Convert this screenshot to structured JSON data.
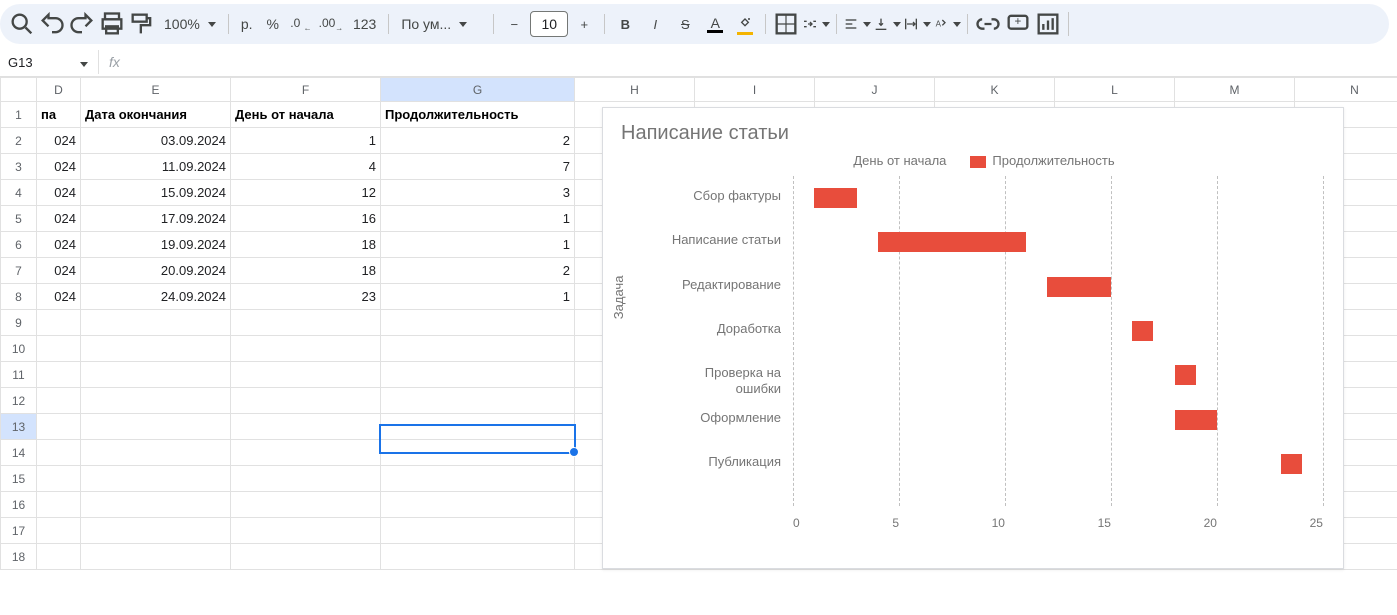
{
  "toolbar": {
    "zoom": "100%",
    "currency": "р.",
    "percent": "%",
    "dec_dec": ".0",
    "dec_inc": ".00",
    "num_123": "123",
    "font_style": "По ум...",
    "font_size": "10"
  },
  "namebox": {
    "cell": "G13",
    "fx": "fx"
  },
  "columns": [
    "D",
    "E",
    "F",
    "G",
    "H",
    "I",
    "J",
    "K",
    "L",
    "M",
    "N"
  ],
  "row_numbers": [
    1,
    2,
    3,
    4,
    5,
    6,
    7,
    8,
    9,
    10,
    11,
    12,
    13,
    14,
    15,
    16,
    17,
    18
  ],
  "headers": {
    "D": "па",
    "E": "Дата окончания",
    "F": "День от начала",
    "G": "Продолжительность"
  },
  "rows": [
    {
      "D": "024",
      "E": "03.09.2024",
      "F": 1,
      "G": 2
    },
    {
      "D": "024",
      "E": "11.09.2024",
      "F": 4,
      "G": 7
    },
    {
      "D": "024",
      "E": "15.09.2024",
      "F": 12,
      "G": 3
    },
    {
      "D": "024",
      "E": "17.09.2024",
      "F": 16,
      "G": 1
    },
    {
      "D": "024",
      "E": "19.09.2024",
      "F": 18,
      "G": 1
    },
    {
      "D": "024",
      "E": "20.09.2024",
      "F": 18,
      "G": 2
    },
    {
      "D": "024",
      "E": "24.09.2024",
      "F": 23,
      "G": 1
    }
  ],
  "active_cell": "G13",
  "chart_data": {
    "type": "bar",
    "title": "Написание статьи",
    "ylabel": "Задача",
    "legend": [
      "День от начала",
      "Продолжительность"
    ],
    "categories": [
      "Сбор фактуры",
      "Написание статьи",
      "Редактирование",
      "Доработка",
      "Проверка на ошибки",
      "Оформление",
      "Публикация"
    ],
    "series": [
      {
        "name": "День от начала",
        "values": [
          1,
          4,
          12,
          16,
          18,
          18,
          23
        ]
      },
      {
        "name": "Продолжительность",
        "values": [
          2,
          7,
          3,
          1,
          1,
          2,
          1
        ]
      }
    ],
    "x_ticks": [
      0,
      5,
      10,
      15,
      20,
      25
    ],
    "xlim": [
      0,
      25
    ]
  }
}
